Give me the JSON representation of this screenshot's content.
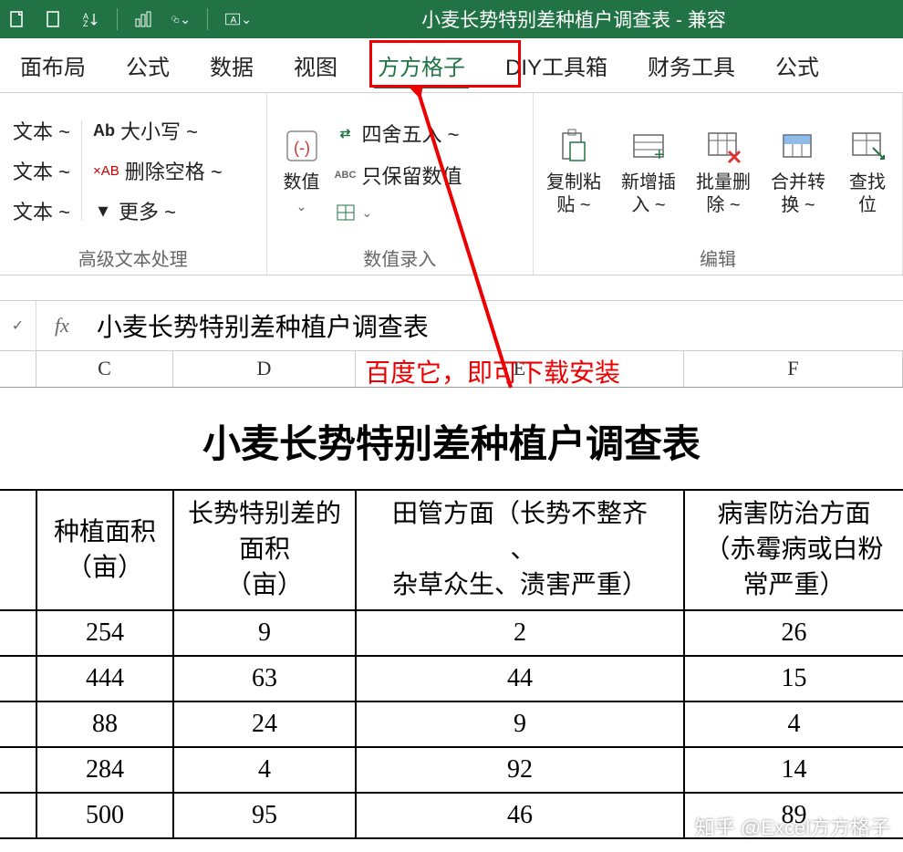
{
  "titlebar": {
    "title": "小麦长势特别差种植户调查表 - 兼容"
  },
  "tabs": {
    "items": [
      "面布局",
      "公式",
      "数据",
      "视图",
      "方方格子",
      "DIY工具箱",
      "财务工具",
      "公式"
    ],
    "active_index": 4
  },
  "ribbon": {
    "group1": {
      "label": "高级文本处理",
      "btn_text_a": "文本 ~",
      "btn_case": "大小写 ~",
      "btn_text_b": "文本 ~",
      "btn_delspace": "删除空格 ~",
      "btn_text_c": "文本 ~",
      "btn_more": "更多 ~",
      "case_prefix": "Ab",
      "delspace_prefix": "×AB"
    },
    "group2": {
      "label": "数值录入",
      "big_numeric": "数值",
      "round": "四舍五入 ~",
      "keep_numeric": "只保留数值",
      "abc_prefix": "ABC"
    },
    "group3": {
      "label": "编辑",
      "copy_paste": "复制粘\n贴 ~",
      "new_insert": "新增插\n入 ~",
      "batch_del": "批量删\n除 ~",
      "merge_conv": "合并转\n换 ~",
      "find_pos": "查找\n位"
    }
  },
  "formula_bar": {
    "fx": "fx",
    "value": "小麦长势特别差种植户调查表"
  },
  "annotation": {
    "text": "百度它，即可下载安装"
  },
  "columns": [
    "C",
    "D",
    "E",
    "F"
  ],
  "sheet": {
    "title": "小麦长势特别差种植户调查表",
    "headers": [
      "种植面积\n（亩）",
      "长势特别差的\n面积\n（亩）",
      "田管方面（长势不整齐\n 、\n杂草众生、渍害严重）",
      "病害防治方面\n（赤霉病或白粉\n常严重）"
    ],
    "rows": [
      [
        "254",
        "9",
        "2",
        "26"
      ],
      [
        "444",
        "63",
        "44",
        "15"
      ],
      [
        "88",
        "24",
        "9",
        "4"
      ],
      [
        "284",
        "4",
        "92",
        "14"
      ],
      [
        "500",
        "95",
        "46",
        "89"
      ]
    ]
  },
  "watermark": "知乎 @Excel方方格子"
}
